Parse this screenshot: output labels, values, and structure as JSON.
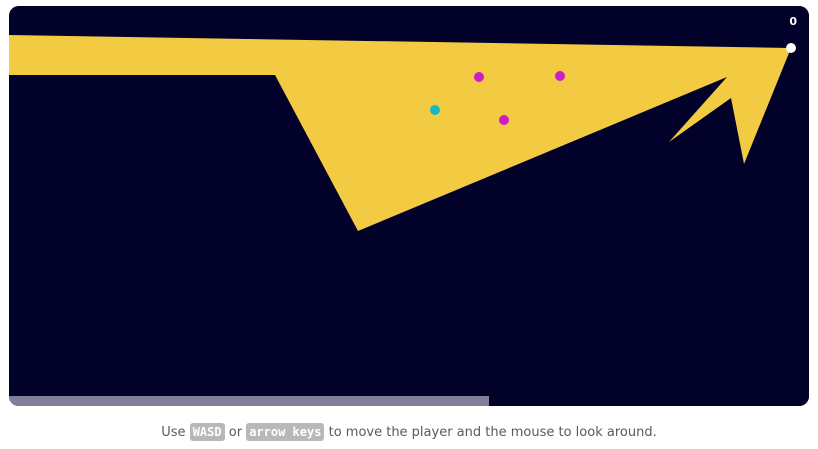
{
  "game": {
    "score": "0",
    "colors": {
      "background": "#01012a",
      "light_beam": "#f3cb42",
      "player": "#ffffff",
      "enemy": "#cc1ccc",
      "pickup": "#16b8c4",
      "progress": "#7f7f99"
    },
    "progress_fraction": 0.6
  },
  "instructions": {
    "prefix": "Use",
    "key1": "WASD",
    "or_text": "or",
    "key2": "arrow keys",
    "suffix": "to move the player and the mouse to look around."
  }
}
